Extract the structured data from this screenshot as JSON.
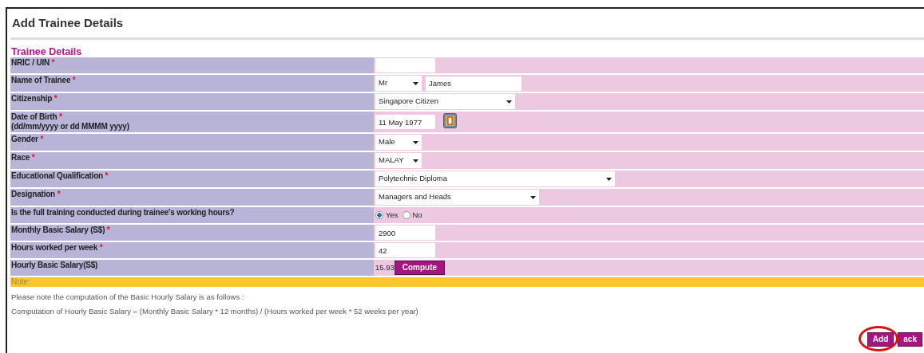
{
  "title": "Add Trainee Details",
  "section": "Trainee Details",
  "rows": [
    {
      "label": "NRIC / UIN",
      "mark": "*",
      "fields": [
        {
          "kind": "input"
        }
      ]
    },
    {
      "label": "Name of Trainee",
      "mark": "*",
      "fields": [
        {
          "kind": "select",
          "value": "Mr"
        },
        {
          "kind": "input",
          "value": "James"
        }
      ]
    },
    {
      "label": "Citizenship",
      "mark": "*",
      "fields": [
        {
          "kind": "select",
          "value": "Singapore Citizen"
        }
      ]
    },
    {
      "label": "Date of Birth",
      "mark": "*",
      "hint": "(dd/mm/yyyy or dd MMMM yyyy)",
      "fields": [
        {
          "kind": "input",
          "value": "11 May 1977"
        },
        {
          "kind": "calendar"
        }
      ]
    },
    {
      "label": "Gender",
      "mark": "*",
      "fields": [
        {
          "kind": "select",
          "value": "Male"
        }
      ]
    },
    {
      "label": "Race",
      "mark": "*",
      "fields": [
        {
          "kind": "select",
          "value": "MALAY"
        }
      ]
    },
    {
      "label": "Educational Qualification",
      "mark": "*",
      "fields": [
        {
          "kind": "select",
          "value": "Polytechnic Diploma"
        }
      ]
    },
    {
      "label": "Designation",
      "mark": "*",
      "fields": [
        {
          "kind": "select",
          "value": "Managers and Heads"
        }
      ]
    },
    {
      "label": "Is the full training conducted during trainee's working hours?",
      "fields": [
        {
          "kind": "radio",
          "options": [
            {
              "label": "Yes",
              "selected": true
            },
            {
              "label": "No",
              "selected": false
            }
          ]
        }
      ]
    },
    {
      "label": "Monthly Basic Salary (S$)",
      "mark": "*",
      "fields": [
        {
          "kind": "input",
          "value": "2900"
        }
      ]
    },
    {
      "label": "Hours worked per week",
      "mark": "*",
      "fields": [
        {
          "kind": "input",
          "value": "42"
        }
      ]
    },
    {
      "label": "Hourly Basic Salary(S$)",
      "fields": [
        {
          "kind": "output",
          "value": "15.93"
        },
        {
          "kind": "button",
          "label": "Compute"
        }
      ]
    }
  ],
  "note": {
    "title": "Note:",
    "lines": [
      "Please note the computation of the Basic Hourly Salary is as follows :",
      "Computation of Hourly Basic Salary = (Monthly Basic Salary * 12 months) / (Hours worked per week * 52 weeks per year)"
    ]
  },
  "buttons": [
    {
      "label": "Add",
      "circled": true
    },
    {
      "label": "ack",
      "circled": false
    }
  ]
}
